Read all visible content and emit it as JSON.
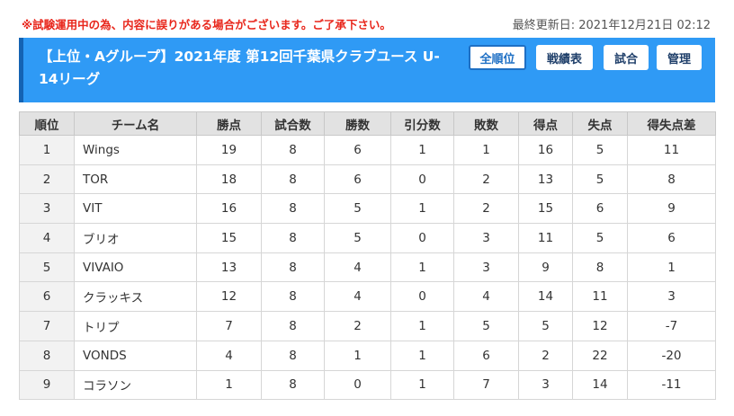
{
  "notice": "※試験運用中の為、内容に誤りがある場合がございます。ご了承下さい。",
  "last_updated": "最終更新日: 2021年12月21日 02:12",
  "header": {
    "title": "【上位・Aグループ】2021年度 第12回千葉県クラブユース U-14リーグ",
    "buttons": {
      "all_standings": "全順位",
      "record": "戦績表",
      "matches": "試合",
      "admin": "管理"
    }
  },
  "colors": {
    "header_bg": "#2f9af5",
    "header_accent": "#1463b3",
    "notice": "#e8261b",
    "table_head_bg": "#e2e2e2"
  },
  "table": {
    "columns": [
      "順位",
      "チーム名",
      "勝点",
      "試合数",
      "勝数",
      "引分数",
      "敗数",
      "得点",
      "失点",
      "得失点差"
    ],
    "rows": [
      [
        "1",
        "Wings",
        "19",
        "8",
        "6",
        "1",
        "1",
        "16",
        "5",
        "11"
      ],
      [
        "2",
        "TOR",
        "18",
        "8",
        "6",
        "0",
        "2",
        "13",
        "5",
        "8"
      ],
      [
        "3",
        "VIT",
        "16",
        "8",
        "5",
        "1",
        "2",
        "15",
        "6",
        "9"
      ],
      [
        "4",
        "ブリオ",
        "15",
        "8",
        "5",
        "0",
        "3",
        "11",
        "5",
        "6"
      ],
      [
        "5",
        "VIVAIO",
        "13",
        "8",
        "4",
        "1",
        "3",
        "9",
        "8",
        "1"
      ],
      [
        "6",
        "クラッキス",
        "12",
        "8",
        "4",
        "0",
        "4",
        "14",
        "11",
        "3"
      ],
      [
        "7",
        "トリプ",
        "7",
        "8",
        "2",
        "1",
        "5",
        "5",
        "12",
        "-7"
      ],
      [
        "8",
        "VONDS",
        "4",
        "8",
        "1",
        "1",
        "6",
        "2",
        "22",
        "-20"
      ],
      [
        "9",
        "コラソン",
        "1",
        "8",
        "0",
        "1",
        "7",
        "3",
        "14",
        "-11"
      ]
    ]
  }
}
